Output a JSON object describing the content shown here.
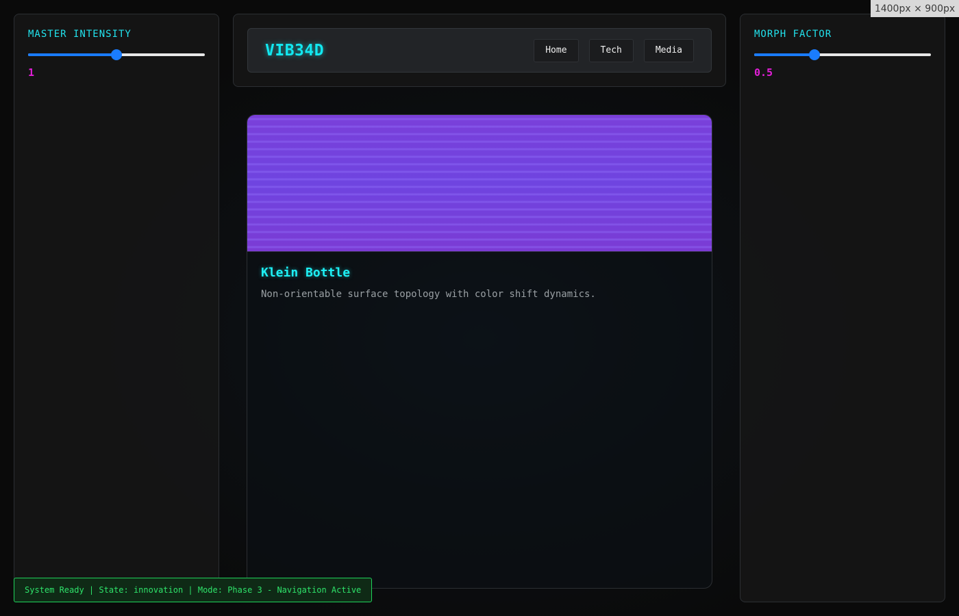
{
  "left_control": {
    "label": "MASTER INTENSITY",
    "value": "1",
    "slider_fraction": 0.5
  },
  "right_control": {
    "label": "MORPH FACTOR",
    "value": "0.5",
    "slider_fraction": 0.34
  },
  "header": {
    "brand": "VIB34D",
    "nav": [
      {
        "label": "Home"
      },
      {
        "label": "Tech"
      },
      {
        "label": "Media"
      }
    ]
  },
  "card": {
    "title": "Klein Bottle",
    "description": "Non-orientable surface topology with color shift dynamics."
  },
  "status": {
    "text": "System Ready | State: innovation | Mode: Phase 3 - Navigation Active"
  },
  "viewport_badge": "1400px × 900px",
  "colors": {
    "accent_cyan": "#12e8f0",
    "accent_magenta": "#e31fd8",
    "slider_blue": "#1a7cff",
    "status_green": "#2ee36a",
    "card_purple": "#7a3fd9"
  }
}
